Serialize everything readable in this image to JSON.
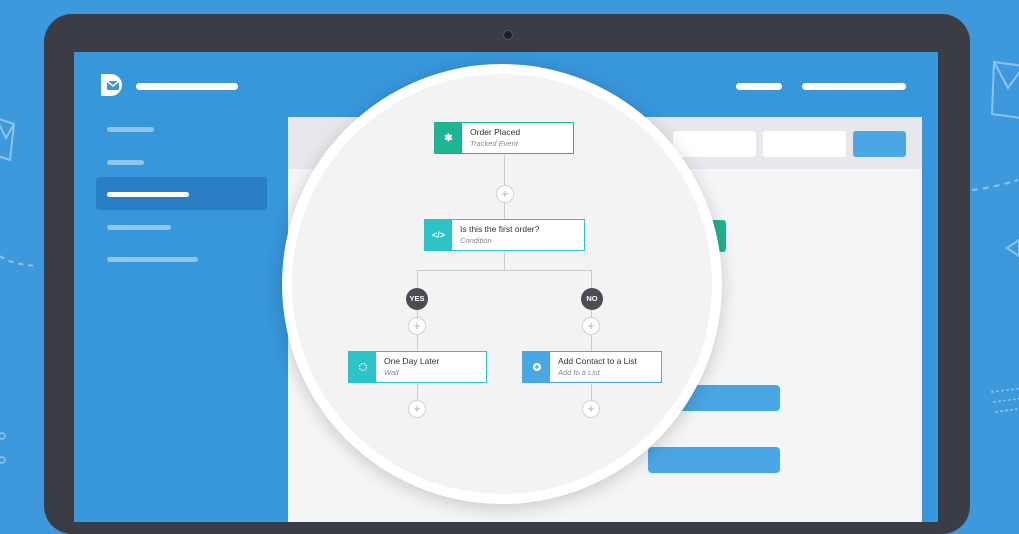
{
  "workflow": {
    "trigger": {
      "title": "Order Placed",
      "subtitle": "Tracked Event",
      "icon": "asterisk-icon",
      "color": "#1fb593"
    },
    "condition": {
      "title": "Is this the first order?",
      "subtitle": "Condition",
      "icon": "code-icon",
      "color": "#2cc4c9"
    },
    "branch_yes": {
      "label": "YES"
    },
    "branch_no": {
      "label": "NO"
    },
    "wait": {
      "title": "One Day Later",
      "subtitle": "Wait",
      "icon": "spinner-icon",
      "color": "#2cc4c9"
    },
    "action": {
      "title": "Add Contact to a List",
      "subtitle": "Add to a List",
      "icon": "plus-circle-icon",
      "color": "#4aa6e4"
    },
    "plus_symbol": "+"
  },
  "colors": {
    "background": "#3d99dc",
    "screen": "#3896db",
    "laptop_bezel": "#3a3d44",
    "accent_green": "#1fb593",
    "accent_teal": "#2cc4c9",
    "accent_blue": "#4aa6e4"
  }
}
